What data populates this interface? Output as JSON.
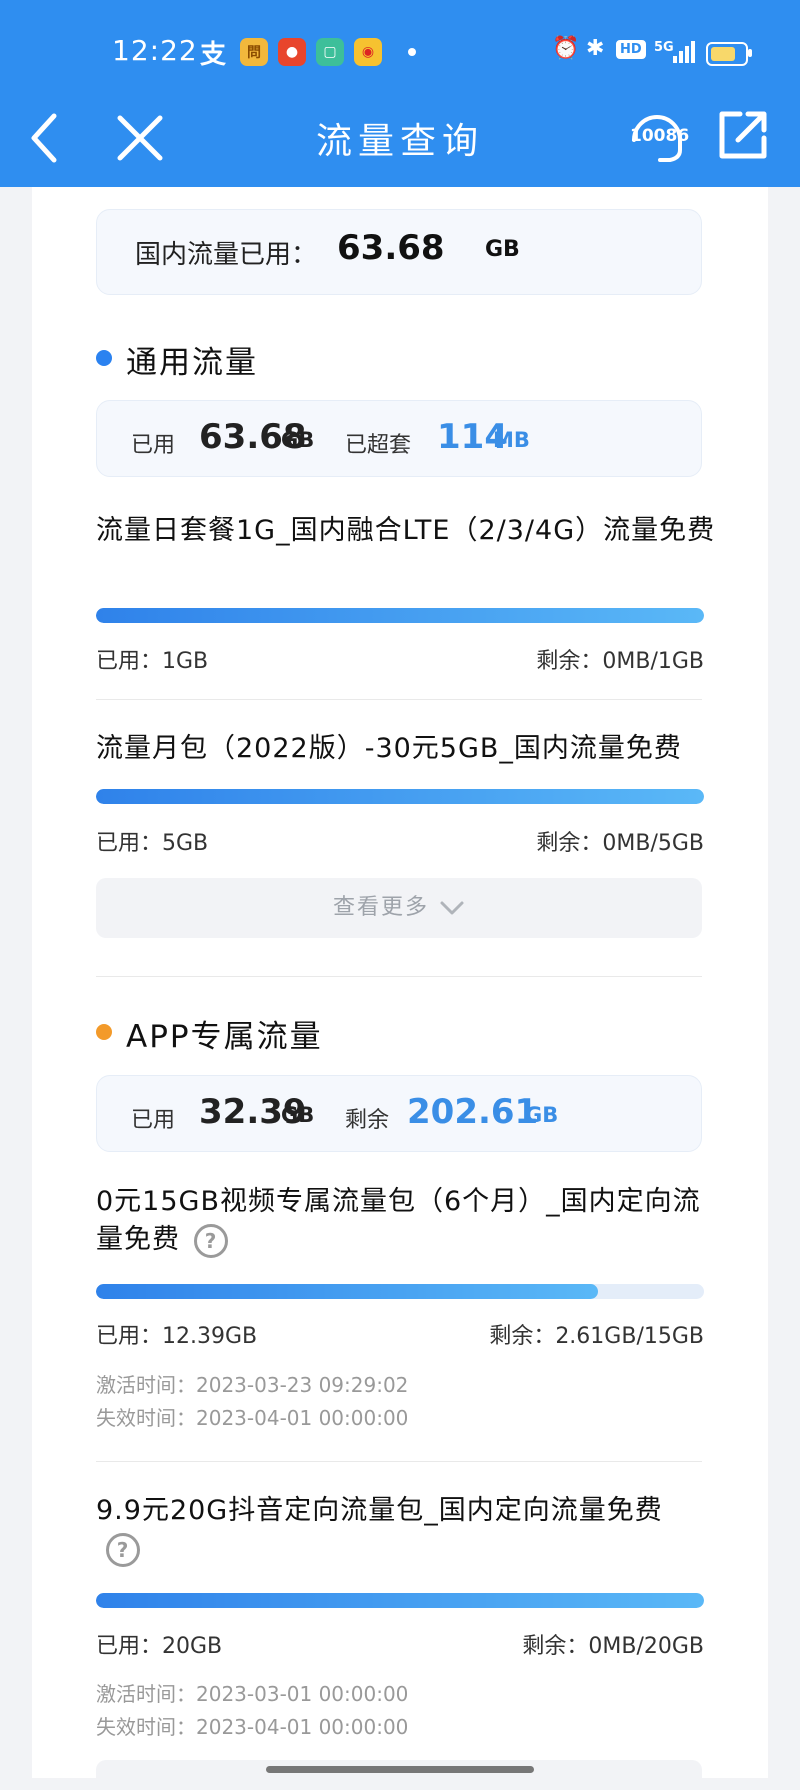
{
  "status_bar": {
    "time": "12:22",
    "network": "5G",
    "hd": "HD"
  },
  "nav": {
    "title": "流量查询",
    "service_number": "10086"
  },
  "domestic": {
    "label": "国内流量已用：",
    "value": "63.68",
    "unit": "GB"
  },
  "general": {
    "title": "通用流量",
    "used_label": "已用",
    "used_value": "63.68",
    "used_unit": "GB",
    "over_label": "已超套",
    "over_value": "114",
    "over_unit": "MB",
    "packages": [
      {
        "name": "流量日套餐1G_国内融合LTE（2/3/4G）流量免费",
        "progress": 1.0,
        "used": "已用：1GB",
        "remain": "剩余：0MB/1GB"
      },
      {
        "name": "流量月包（2022版）-30元5GB_国内流量免费",
        "progress": 1.0,
        "used": "已用：5GB",
        "remain": "剩余：0MB/5GB"
      }
    ],
    "more_label": "查看更多"
  },
  "app": {
    "title": "APP专属流量",
    "used_label": "已用",
    "used_value": "32.39",
    "used_unit": "GB",
    "remain_label": "剩余",
    "remain_value": "202.61",
    "remain_unit": "GB",
    "packages": [
      {
        "name": "0元15GB视频专属流量包（6个月）_国内定向流量免费",
        "progress": 0.826,
        "used": "已用：12.39GB",
        "remain": "剩余：2.61GB/15GB",
        "activated": "激活时间：2023-03-23 09:29:02",
        "expires": "失效时间：2023-04-01 00:00:00"
      },
      {
        "name": "9.9元20G抖音定向流量包_国内定向流量免费",
        "progress": 1.0,
        "used": "已用：20GB",
        "remain": "剩余：0MB/20GB",
        "activated": "激活时间：2023-03-01 00:00:00",
        "expires": "失效时间：2023-04-01 00:00:00"
      }
    ]
  },
  "colors": {
    "header": "#2f8ef0",
    "accent_blue": "#3a8ee6",
    "dot_general": "#2b82f0",
    "dot_app": "#f39a2a"
  }
}
